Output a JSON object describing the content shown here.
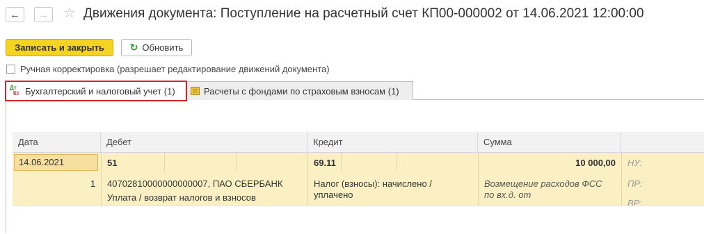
{
  "header": {
    "back_icon": "arrow-left-icon",
    "forward_icon": "arrow-right-icon",
    "favorite_icon": "star-icon",
    "title": "Движения документа: Поступление на расчетный счет КП00-000002 от 14.06.2021 12:00:00"
  },
  "toolbar": {
    "save_close_label": "Записать и закрыть",
    "refresh_label": "Обновить",
    "refresh_icon": "refresh-icon"
  },
  "manual_adjust": {
    "label": "Ручная корректировка (разрешает редактирование движений документа)",
    "checked": false
  },
  "tabs": [
    {
      "label": "Бухгалтерский и налоговый учет (1)",
      "icon": "dt-kt-icon",
      "active": true
    },
    {
      "label": "Расчеты с фондами по страховым взносам (1)",
      "icon": "register-icon",
      "active": false
    }
  ],
  "dtkt_icon_text": {
    "dt": "Дт",
    "kt": "Кт"
  },
  "grid": {
    "columns": [
      "Дата",
      "Дебет",
      "Кредит",
      "Сумма"
    ],
    "row": {
      "date": "14.06.2021",
      "number": "1",
      "debit_account": "51",
      "debit_subconto": "40702810000000000007, ПАО СБЕРБАНК",
      "debit_subconto2": "Уплата / возврат налогов и взносов",
      "credit_account": "69.11",
      "credit_subconto": "Налог (взносы): начислено /",
      "credit_subconto_cont": "уплачено",
      "amount": "10 000,00",
      "content_line1": "Возмещение расходов ФСС",
      "content_line2": "по вх.д.  от",
      "nu_label": "НУ:",
      "pr_label": "ПР:",
      "vr_label": "ВР:"
    }
  },
  "colors": {
    "accent_button": "#f5d41f",
    "active_row": "#fbf0c4",
    "highlight_border": "#d32525"
  }
}
